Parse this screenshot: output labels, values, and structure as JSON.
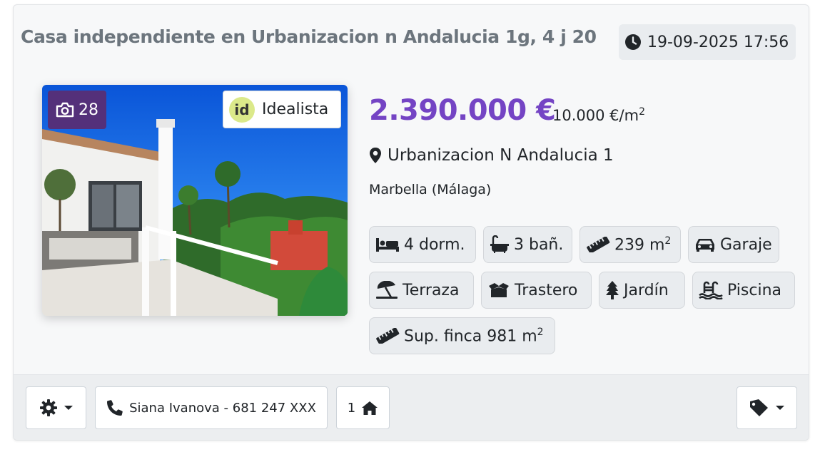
{
  "listing": {
    "title": "Casa independiente en Urbanizacion n Andalucia 1g, 4 j 20",
    "datetime": "19-09-2025 17:56",
    "photo_count": "28",
    "source": "Idealista",
    "source_logo": "id",
    "price": "2.390.000 €",
    "price_per_m2": "10.000 €/m",
    "price_per_m2_unit_sup": "2",
    "address": "Urbanizacion N Andalucia 1",
    "city": "Marbella (Málaga)"
  },
  "features": [
    {
      "icon": "bed-icon",
      "label": "4 dorm.",
      "sup": ""
    },
    {
      "icon": "bath-icon",
      "label": "3 bañ.",
      "sup": ""
    },
    {
      "icon": "ruler-icon",
      "label": "239 m",
      "sup": "2"
    },
    {
      "icon": "car-icon",
      "label": "Garaje",
      "sup": ""
    },
    {
      "icon": "umbrella-beach-icon",
      "label": "Terraza",
      "sup": ""
    },
    {
      "icon": "box-open-icon",
      "label": "Trastero",
      "sup": ""
    },
    {
      "icon": "tree-icon",
      "label": "Jardín",
      "sup": ""
    },
    {
      "icon": "swimming-pool-icon",
      "label": "Piscina",
      "sup": ""
    },
    {
      "icon": "ruler-icon",
      "label": "Sup. finca 981 m",
      "sup": "2"
    }
  ],
  "footer": {
    "contact_label": "Siana Ivanova - 681 247 XXX",
    "properties_count": "1"
  },
  "colors": {
    "price": "#7444c4",
    "photo_badge": "#54307a",
    "title": "#6c757d"
  }
}
